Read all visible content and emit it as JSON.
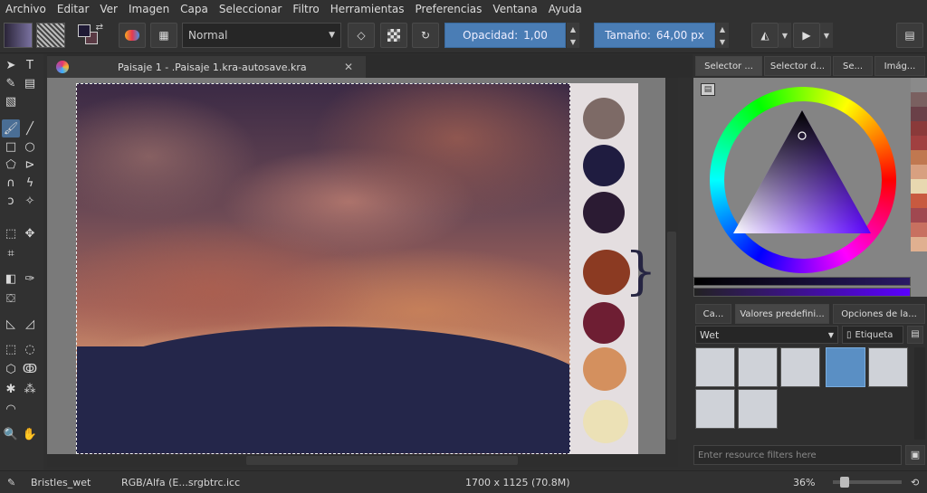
{
  "menu": [
    "Archivo",
    "Editar",
    "Ver",
    "Imagen",
    "Capa",
    "Seleccionar",
    "Filtro",
    "Herramientas",
    "Preferencias",
    "Ventana",
    "Ayuda"
  ],
  "toolbar": {
    "blend_mode": "Normal",
    "opacity_label": "Opacidad:",
    "opacity_value": "1,00",
    "size_label": "Tamaño:",
    "size_value": "64,00 px"
  },
  "document": {
    "tab_title": "Paisaje 1 - .Paisaje 1.kra-autosave.kra"
  },
  "docker": {
    "top_tabs": [
      "Selector ...",
      "Selector d...",
      "Se...",
      "Imág..."
    ],
    "bottom_tabs": [
      "Ca...",
      "Valores predefini...",
      "Opciones de la..."
    ],
    "preset_dropdown": "Wet",
    "tag_label": "Etiqueta",
    "filter_placeholder": "Enter resource filters here"
  },
  "palette_colors": [
    "#7d6a66",
    "#1f1c40",
    "#2b1b33",
    "#8b3a22",
    "#6e1e33",
    "#d4905e",
    "#ece1b6"
  ],
  "recent_colors": [
    "#8a8a8a",
    "#7a6060",
    "#6a4048",
    "#8a3a3a",
    "#a04040",
    "#c07850",
    "#d8a080",
    "#e8d8b0",
    "#c85a40",
    "#a04850",
    "#c87060",
    "#e0b090"
  ],
  "status": {
    "brush": "Bristles_wet",
    "color_space": "RGB/Alfa (E...srgbtrc.icc",
    "dimensions": "1700 x 1125 (70.8M)",
    "zoom": "36%"
  }
}
